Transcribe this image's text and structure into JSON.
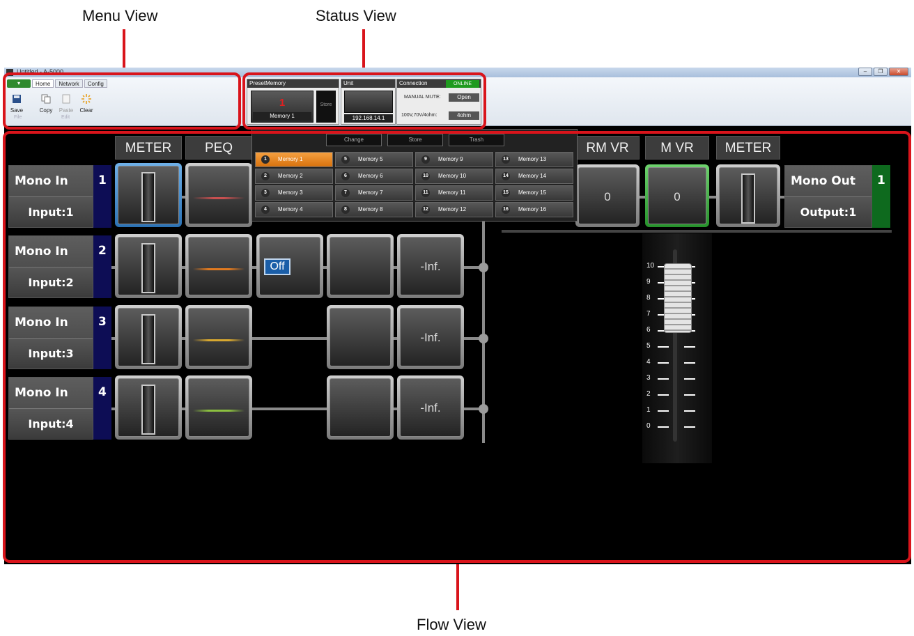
{
  "callouts": {
    "menu_view": "Menu View",
    "status_view": "Status View",
    "flow_view": "Flow View"
  },
  "window": {
    "title": "Untitled - A-5000",
    "buttons": [
      "minimize",
      "restore",
      "close"
    ]
  },
  "ribbon": {
    "tabs": [
      "Home",
      "Network",
      "Config"
    ],
    "active_tab": "Home",
    "buttons": [
      {
        "label": "Save",
        "icon": "save-icon"
      },
      {
        "label": "Copy",
        "icon": "copy-icon"
      },
      {
        "label": "Paste",
        "icon": "paste-icon"
      },
      {
        "label": "Clear",
        "icon": "clear-icon"
      }
    ],
    "group_labels": [
      "File",
      "Edit"
    ]
  },
  "status": {
    "preset": {
      "header": "PresetMemory",
      "number": "1",
      "name": "Memory 1",
      "store": "Store"
    },
    "unit": {
      "header": "Unit",
      "ip": "192.168.14.1"
    },
    "connection": {
      "header": "Connection",
      "state": "ONLINE",
      "mute_label": "MANUAL MUTE:",
      "mute_value": "Open",
      "output_label": "100V,70V/4ohm:",
      "output_value": "4ohm"
    }
  },
  "flow": {
    "headers_left": [
      "METER",
      "PEQ"
    ],
    "headers_right": [
      "RM VR",
      "M VR",
      "METER"
    ],
    "inputs": [
      {
        "name": "Mono In",
        "num": "1",
        "port": "Input:1",
        "peq_color": "#c85050"
      },
      {
        "name": "Mono In",
        "num": "2",
        "port": "Input:2",
        "peq_color": "#e07a20",
        "gate": "Off",
        "level": "-Inf."
      },
      {
        "name": "Mono In",
        "num": "3",
        "port": "Input:3",
        "peq_color": "#d8a830",
        "level": "-Inf."
      },
      {
        "name": "Mono In",
        "num": "4",
        "port": "Input:4",
        "peq_color": "#8cc040",
        "level": "-Inf."
      }
    ],
    "output": {
      "name": "Mono Out",
      "num": "1",
      "port": "Output:1",
      "rm_vr": "0",
      "m_vr": "0"
    },
    "fader_ticks": [
      "10",
      "9",
      "8",
      "7",
      "6",
      "5",
      "4",
      "3",
      "2",
      "1",
      "0"
    ]
  },
  "preset_dropdown": {
    "actions": [
      "Change",
      "Store",
      "Trash"
    ],
    "memories": [
      {
        "num": "1",
        "label": "Memory 1"
      },
      {
        "num": "2",
        "label": "Memory 2"
      },
      {
        "num": "3",
        "label": "Memory 3"
      },
      {
        "num": "4",
        "label": "Memory 4"
      },
      {
        "num": "5",
        "label": "Memory 5"
      },
      {
        "num": "6",
        "label": "Memory 6"
      },
      {
        "num": "7",
        "label": "Memory 7"
      },
      {
        "num": "8",
        "label": "Memory 8"
      },
      {
        "num": "9",
        "label": "Memory 9"
      },
      {
        "num": "10",
        "label": "Memory 10"
      },
      {
        "num": "11",
        "label": "Memory 11"
      },
      {
        "num": "12",
        "label": "Memory 12"
      },
      {
        "num": "13",
        "label": "Memory 13"
      },
      {
        "num": "14",
        "label": "Memory 14"
      },
      {
        "num": "15",
        "label": "Memory 15"
      },
      {
        "num": "16",
        "label": "Memory 16"
      }
    ],
    "selected": "1"
  }
}
